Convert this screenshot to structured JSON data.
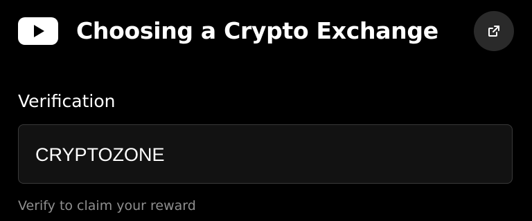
{
  "header": {
    "logo_icon": "youtube-play-icon",
    "title": "Choosing a Crypto Exchange",
    "open_external_icon": "external-link-icon"
  },
  "form": {
    "label": "Verification",
    "input_value": "CRYPTOZONE",
    "helper_text": "Verify to claim your reward"
  },
  "colors": {
    "background": "#000000",
    "input_background": "#121212",
    "input_border": "#3a3a3a",
    "button_background": "#2a2a2a",
    "text": "#ffffff",
    "helper_text": "#8f8f8f"
  }
}
